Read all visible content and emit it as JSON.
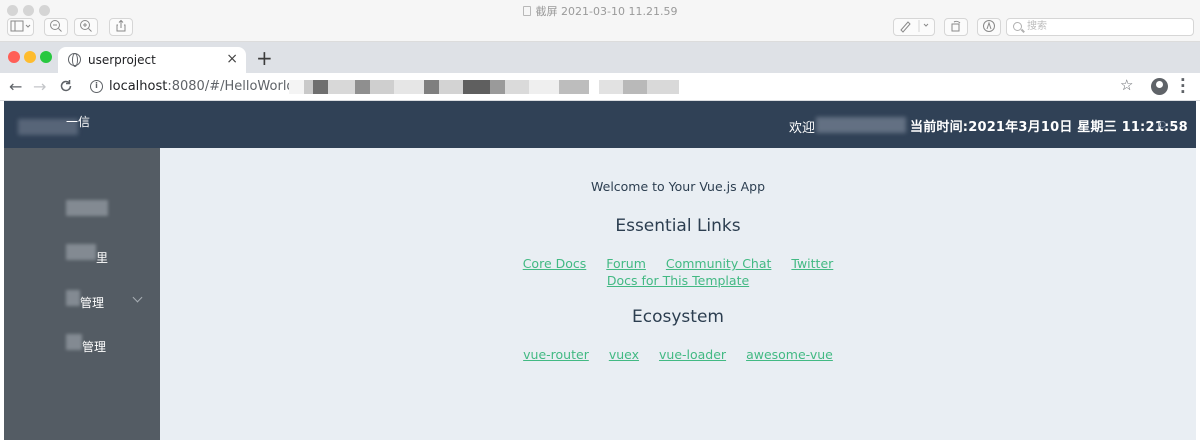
{
  "preview": {
    "title": "截屏 2021-03-10 11.21.59",
    "search_placeholder": "搜索"
  },
  "browser": {
    "tab_title": "userproject",
    "tab_close": "×",
    "new_tab": "+",
    "url_host": "localhost",
    "url_path": ":8080/#/HelloWorld",
    "back": "←",
    "forward": "→",
    "reload": "C",
    "star": "☆"
  },
  "header": {
    "brand_fragment": "一信",
    "welcome_prefix": "欢迎",
    "clock": "当前时间:2021年3月10日 星期三  11:21:58"
  },
  "sidebar": {
    "items": [
      {
        "label": ""
      },
      {
        "label": "里"
      },
      {
        "label": "管理",
        "has_submenu": true
      },
      {
        "label": "管理"
      }
    ]
  },
  "hello": {
    "msg": "Welcome to Your Vue.js App",
    "essential_heading": "Essential Links",
    "essential_links": [
      "Core Docs",
      "Forum",
      "Community Chat",
      "Twitter",
      "Docs for This Template"
    ],
    "ecosystem_heading": "Ecosystem",
    "ecosystem_links": [
      "vue-router",
      "vuex",
      "vue-loader",
      "awesome-vue"
    ]
  },
  "colors": {
    "header_bg": "#304156",
    "sidebar_bg": "#545c64",
    "main_bg": "#e9eef3",
    "link": "#42b983",
    "text": "#2c3e50"
  }
}
